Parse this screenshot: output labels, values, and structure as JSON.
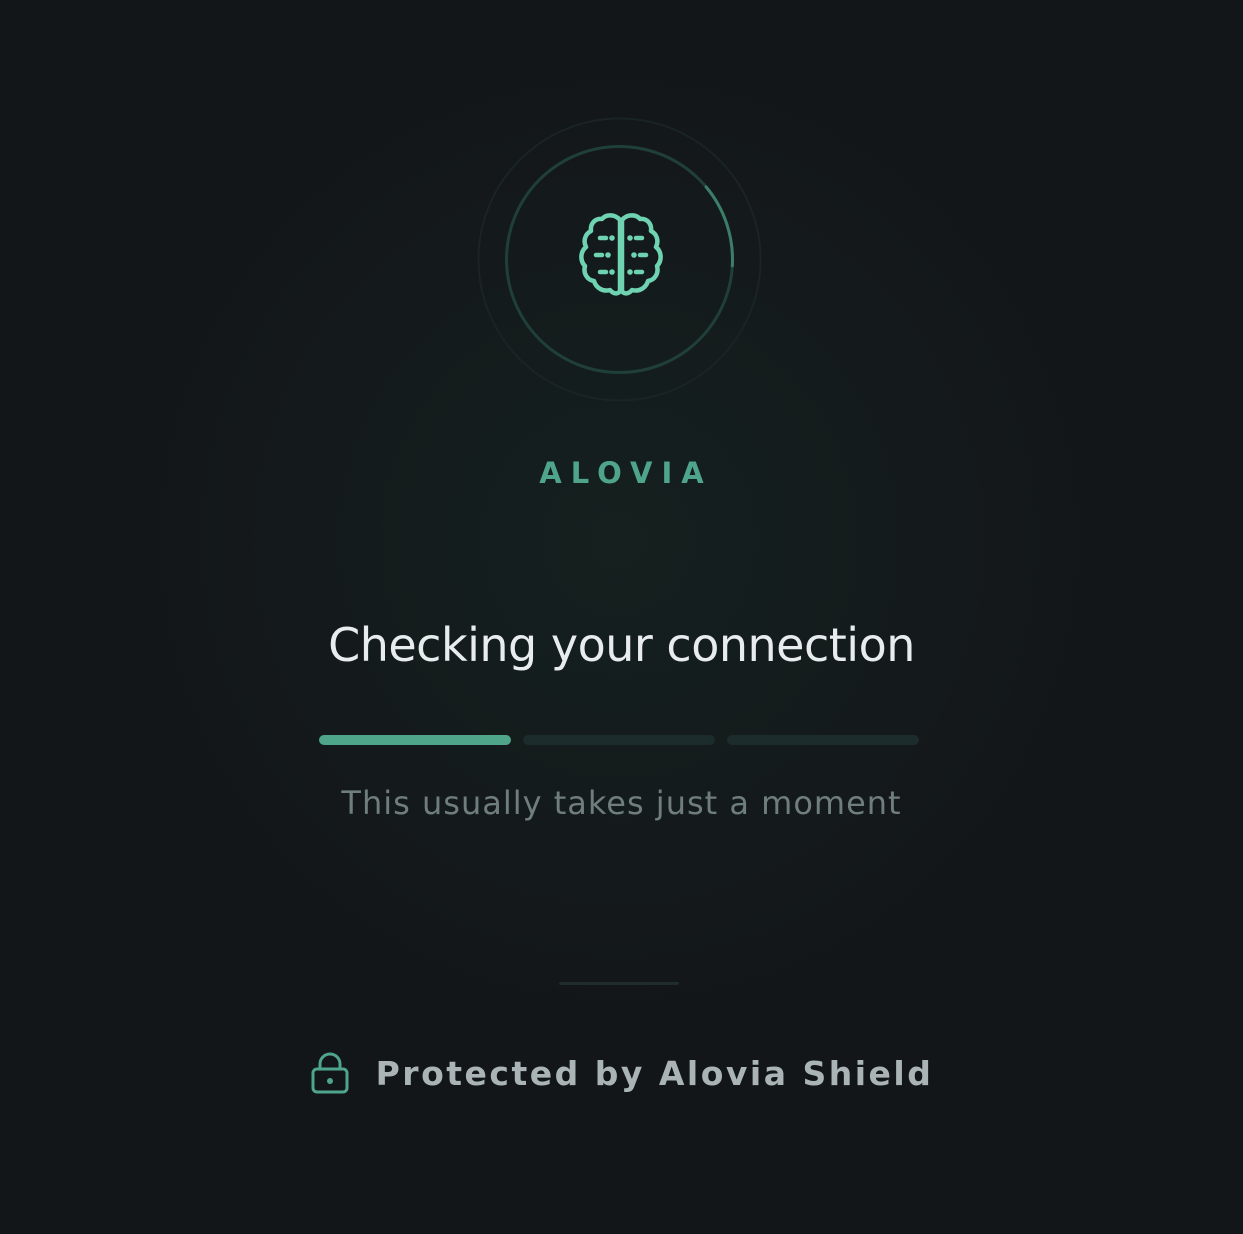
{
  "brand": {
    "name": "ALOVIA",
    "logo_icon": "brain-icon",
    "accent_color": "#4fa58a",
    "icon_color": "#6fd3b1"
  },
  "status": {
    "heading": "Checking your connection",
    "subtext": "This usually takes just a moment",
    "progress_steps_total": 3,
    "progress_steps_complete": 1,
    "spinner_arc_fraction": 0.12
  },
  "footer": {
    "lock_icon": "lock-icon",
    "text": "Protected by Alovia Shield"
  }
}
